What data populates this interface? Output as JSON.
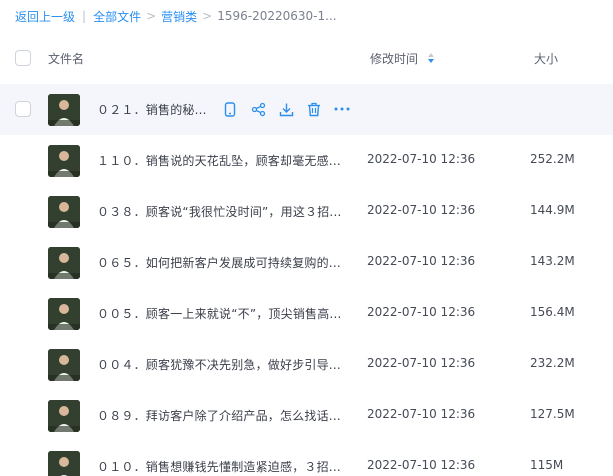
{
  "breadcrumb": {
    "back": "返回上一级",
    "separator": "|",
    "all_files": "全部文件",
    "folder": "营销类",
    "current": "1596-20220630-1..."
  },
  "header": {
    "name": "文件名",
    "modified": "修改时间",
    "size": "大小"
  },
  "files": [
    {
      "name": "０２１．销售的秘...",
      "date": "",
      "size": ""
    },
    {
      "name": "１１０．销售说的天花乱坠，顾客却毫无感...",
      "date": "2022-07-10 12:36",
      "size": "252.2M"
    },
    {
      "name": "０３８．顾客说“我很忙没时间”，用这３招...",
      "date": "2022-07-10 12:36",
      "size": "144.9M"
    },
    {
      "name": "０６５．如何把新客户发展成可持续复购的...",
      "date": "2022-07-10 12:36",
      "size": "143.2M"
    },
    {
      "name": "００５．顾客一上来就说“不”，顶尖销售高...",
      "date": "2022-07-10 12:36",
      "size": "156.4M"
    },
    {
      "name": "００４．顾客犹豫不决先别急，做好步引导...",
      "date": "2022-07-10 12:36",
      "size": "232.2M"
    },
    {
      "name": "０８９．拜访客户除了介绍产品，怎么找话...",
      "date": "2022-07-10 12:36",
      "size": "127.5M"
    },
    {
      "name": "０１０．销售想赚钱先懂制造紧迫感，３招...",
      "date": "2022-07-10 12:36",
      "size": "115M"
    }
  ],
  "row_actions": [
    "phone-icon",
    "share-icon",
    "download-icon",
    "trash-icon",
    "more-icon"
  ],
  "colors": {
    "accent": "#2b8ff0",
    "hover_row": "#f4f6fb"
  }
}
